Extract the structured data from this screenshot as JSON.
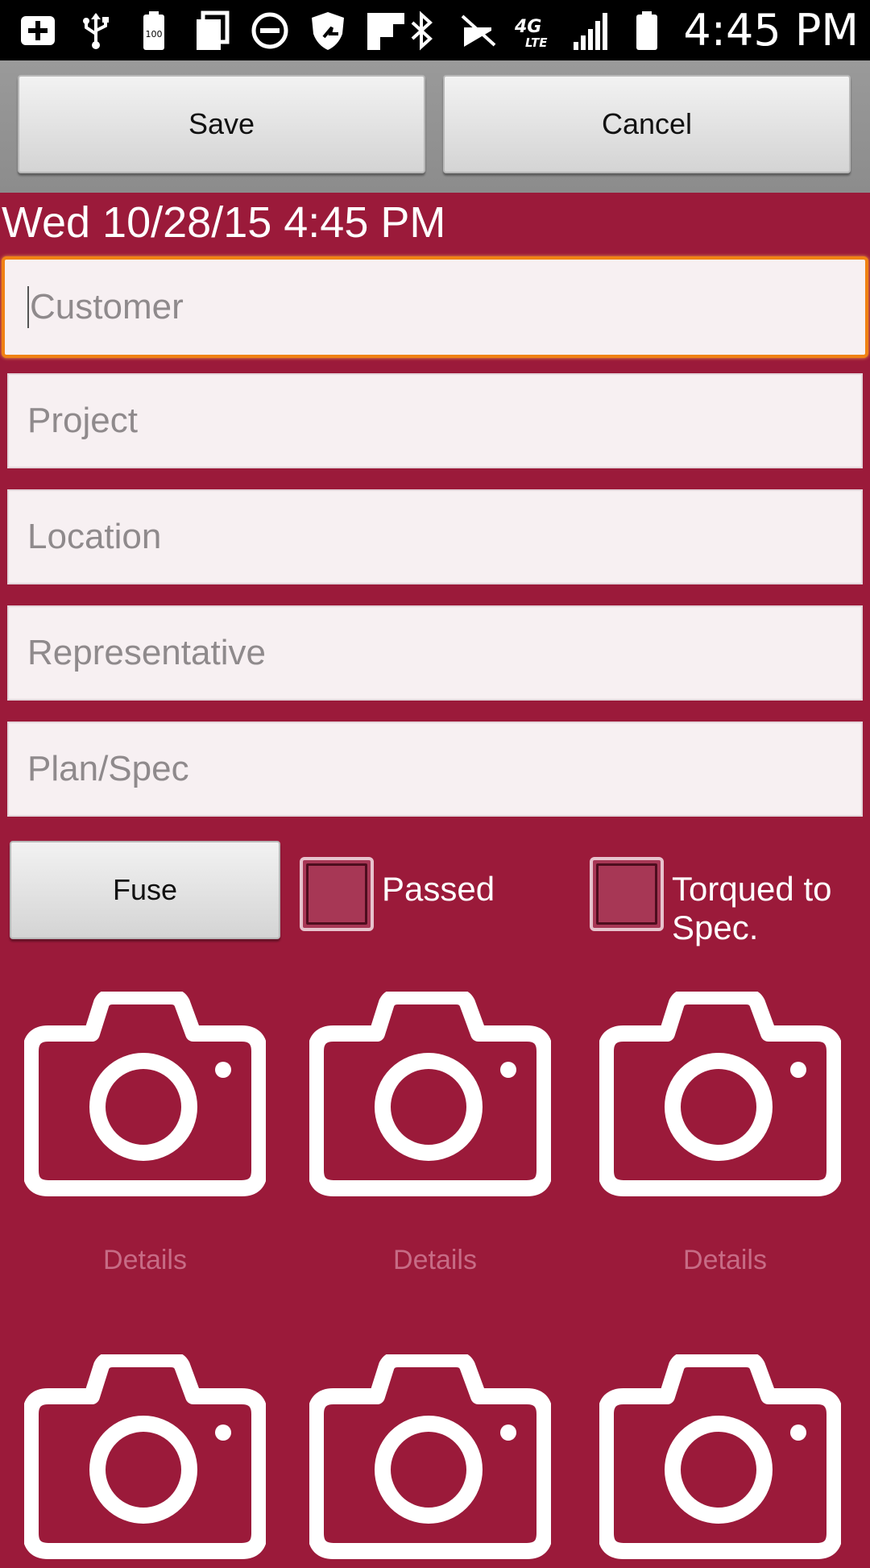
{
  "status_bar": {
    "icons_left": [
      "add-icon",
      "usb-icon",
      "battery-100-icon",
      "copy-icon",
      "do-not-disturb-icon",
      "shield-icon",
      "flipboard-icon"
    ],
    "battery_label": "100",
    "icons_right": [
      "bluetooth-icon",
      "vibrate-off-icon",
      "4g-lte-icon",
      "signal-icon",
      "battery-icon"
    ],
    "network_label": "4G LTE",
    "time": "4:45 PM"
  },
  "toolbar": {
    "save_label": "Save",
    "cancel_label": "Cancel"
  },
  "datetime": "Wed 10/28/15 4:45 PM",
  "fields": {
    "customer_placeholder": "Customer",
    "project_placeholder": "Project",
    "location_placeholder": "Location",
    "representative_placeholder": "Representative",
    "plan_spec_placeholder": "Plan/Spec"
  },
  "options": {
    "fuse_label": "Fuse",
    "passed_label": "Passed",
    "passed_checked": false,
    "torqued_label_line1": "Torqued to",
    "torqued_label_line2": "Spec.",
    "torqued_checked": false
  },
  "photos": {
    "details_label": "Details",
    "icon": "camera-icon"
  },
  "colors": {
    "background": "#9b1a3a",
    "focus_border": "#f08214",
    "details_text": "#c76b85"
  }
}
